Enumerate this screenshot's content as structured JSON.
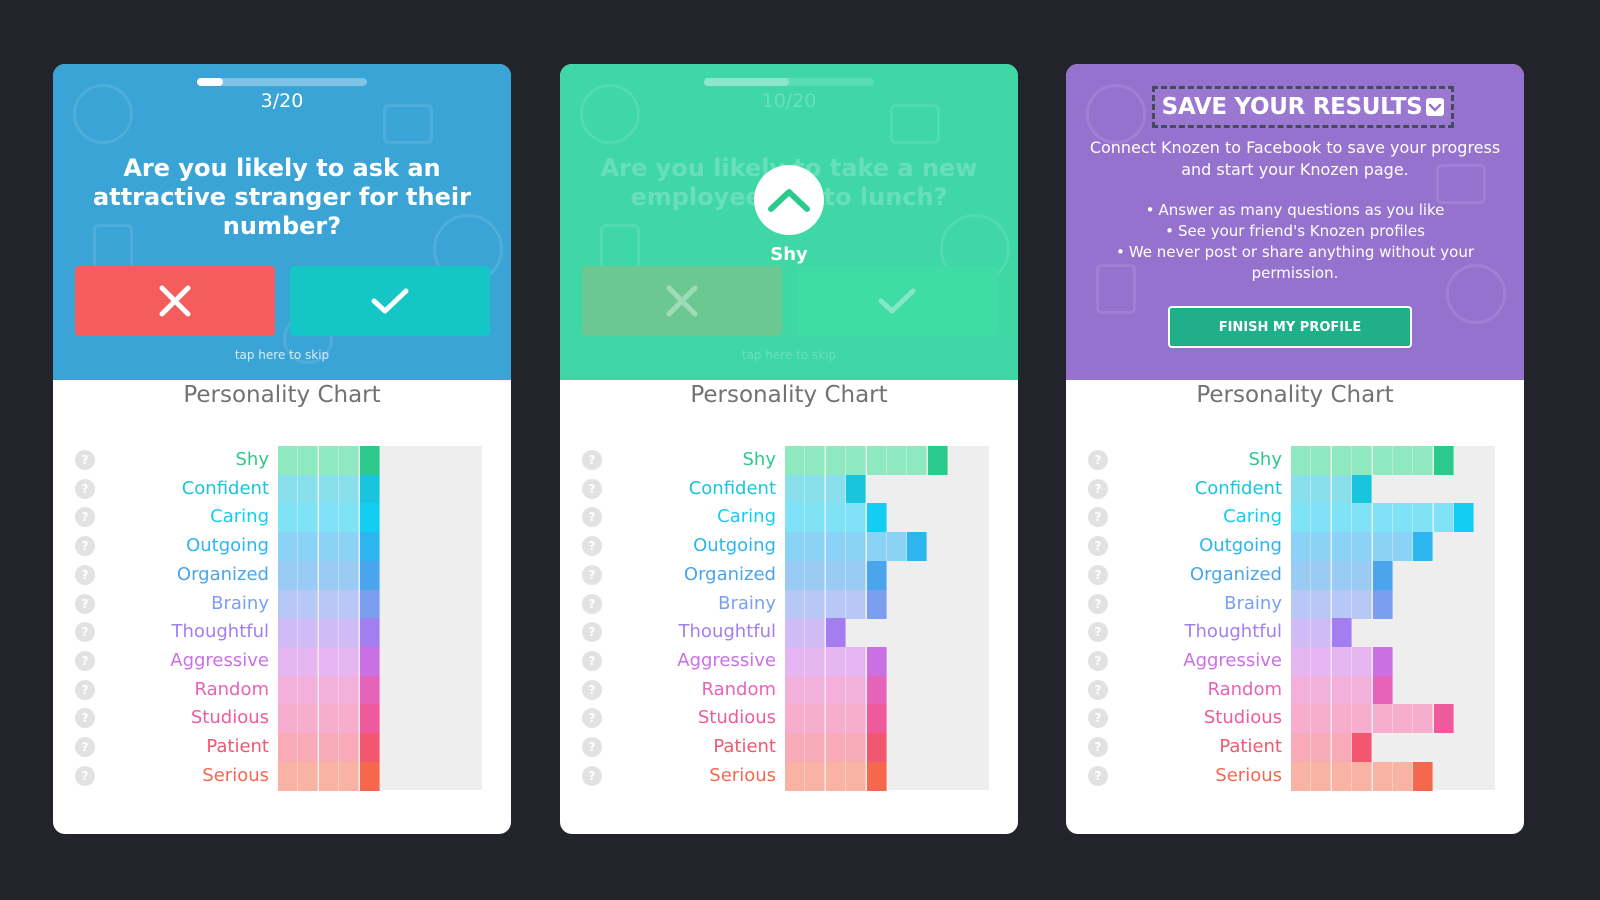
{
  "traits": [
    {
      "name": "Shy",
      "color": "#2cc98c",
      "light": "#8ee8c0"
    },
    {
      "name": "Confident",
      "color": "#18c5dc",
      "light": "#89e0ec"
    },
    {
      "name": "Caring",
      "color": "#13cdf2",
      "light": "#7fe2f7"
    },
    {
      "name": "Outgoing",
      "color": "#2db5f0",
      "light": "#8ad3f6"
    },
    {
      "name": "Organized",
      "color": "#4aa5ec",
      "light": "#9acbf4"
    },
    {
      "name": "Brainy",
      "color": "#7c9ef0",
      "light": "#b7c8f6"
    },
    {
      "name": "Thoughtful",
      "color": "#a37ef0",
      "light": "#cfbcf7"
    },
    {
      "name": "Aggressive",
      "color": "#ca70e5",
      "light": "#e6b6f2"
    },
    {
      "name": "Random",
      "color": "#e563b8",
      "light": "#f2b0db"
    },
    {
      "name": "Studious",
      "color": "#ef5a9c",
      "light": "#f7adcd"
    },
    {
      "name": "Patient",
      "color": "#f2576f",
      "light": "#f8abb7"
    },
    {
      "name": "Serious",
      "color": "#f5684e",
      "light": "#f9b3a5"
    }
  ],
  "cards": [
    {
      "theme": "blue",
      "progress": 0.15,
      "counter": "3/20",
      "question": "Are you likely to ask an attractive stranger for their number?",
      "skip": "tap here to skip",
      "chart_title": "Personality Chart",
      "levels": [
        5,
        5,
        5,
        5,
        5,
        5,
        5,
        5,
        5,
        5,
        5,
        5
      ]
    },
    {
      "theme": "green",
      "progress": 0.5,
      "counter": "10/20",
      "question": "Are you likely to take a new employee out to lunch?",
      "skip": "tap here to skip",
      "overlay_label": "Shy",
      "chart_title": "Personality Chart",
      "levels": [
        8,
        4,
        5,
        7,
        5,
        5,
        3,
        5,
        5,
        5,
        5,
        5
      ]
    },
    {
      "theme": "purple",
      "save_title": "SAVE YOUR RESULTS",
      "save_desc": "Connect Knozen to Facebook to save your progress and start your Knozen page.",
      "bullets": [
        "Answer as many questions as you like",
        "See your friend's Knozen profiles",
        "We never post or share anything without your permission."
      ],
      "finish_label": "FINISH MY PROFILE",
      "chart_title": "Personality Chart",
      "levels": [
        8,
        4,
        9,
        7,
        5,
        5,
        3,
        5,
        5,
        8,
        4,
        7
      ]
    }
  ],
  "colors": {
    "background": "#23232c",
    "blue_hero": "#3aa4d6",
    "green_hero": "#3fd7a6",
    "purple_hero": "#9672cf",
    "no_button": "#f55c5c",
    "yes_button": "#14c6c5",
    "finish_button": "#1fb08a"
  },
  "icons": {
    "no": "close-icon",
    "yes": "check-icon",
    "up": "chevron-up-icon",
    "help": "question-icon"
  }
}
